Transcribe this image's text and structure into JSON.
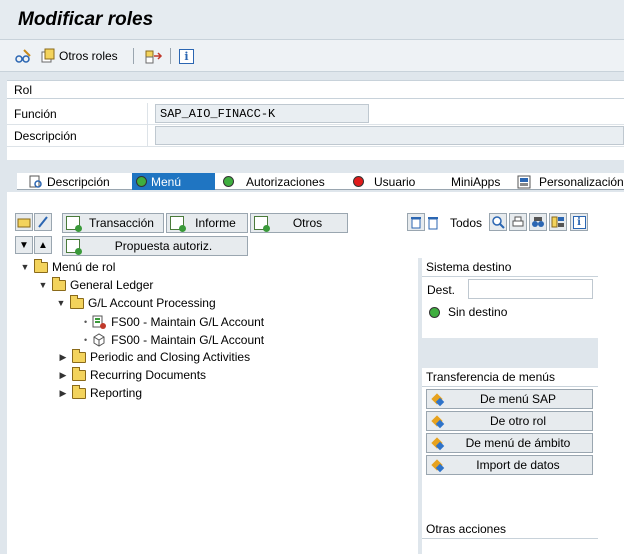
{
  "header": {
    "title": "Modificar roles"
  },
  "toolbar": {
    "otros_roles": "Otros roles"
  },
  "rol_panel": {
    "heading": "Rol",
    "funcion_label": "Función",
    "funcion_value": "SAP_AIO_FINACC-K",
    "descripcion_label": "Descripción",
    "descripcion_value": ""
  },
  "tabs": [
    {
      "label": "Descripción",
      "active": false
    },
    {
      "label": "Menú",
      "active": true
    },
    {
      "label": "Autorizaciones",
      "active": false
    },
    {
      "label": "Usuario",
      "active": false
    },
    {
      "label": "MiniApps",
      "active": false
    },
    {
      "label": "Personalización",
      "active": false
    }
  ],
  "menu_toolbar": {
    "transaccion": "Transacción",
    "informe": "Informe",
    "otros": "Otros",
    "propuesta": "Propuesta autoriz.",
    "todos": "Todos"
  },
  "tree": {
    "root": "Menú de rol",
    "general_ledger": "General Ledger",
    "gl_processing": "G/L Account Processing",
    "fs00_a": "FS00 - Maintain G/L Account",
    "fs00_b": "FS00 - Maintain G/L Account",
    "periodic": "Periodic and Closing Activities",
    "recurring": "Recurring Documents",
    "reporting": "Reporting"
  },
  "sistema_destino": {
    "title": "Sistema destino",
    "dest_label": "Dest.",
    "dest_value": "",
    "status": "Sin destino"
  },
  "transferencia": {
    "title": "Transferencia de menús",
    "buttons": [
      "De menú SAP",
      "De otro rol",
      "De menú de ámbito",
      "Import de datos"
    ]
  },
  "otras_acciones": {
    "title": "Otras acciones"
  },
  "colors": {
    "active_tab": "#1f75c2",
    "status_green": "#3fae3f",
    "status_red": "#e01b1b"
  }
}
